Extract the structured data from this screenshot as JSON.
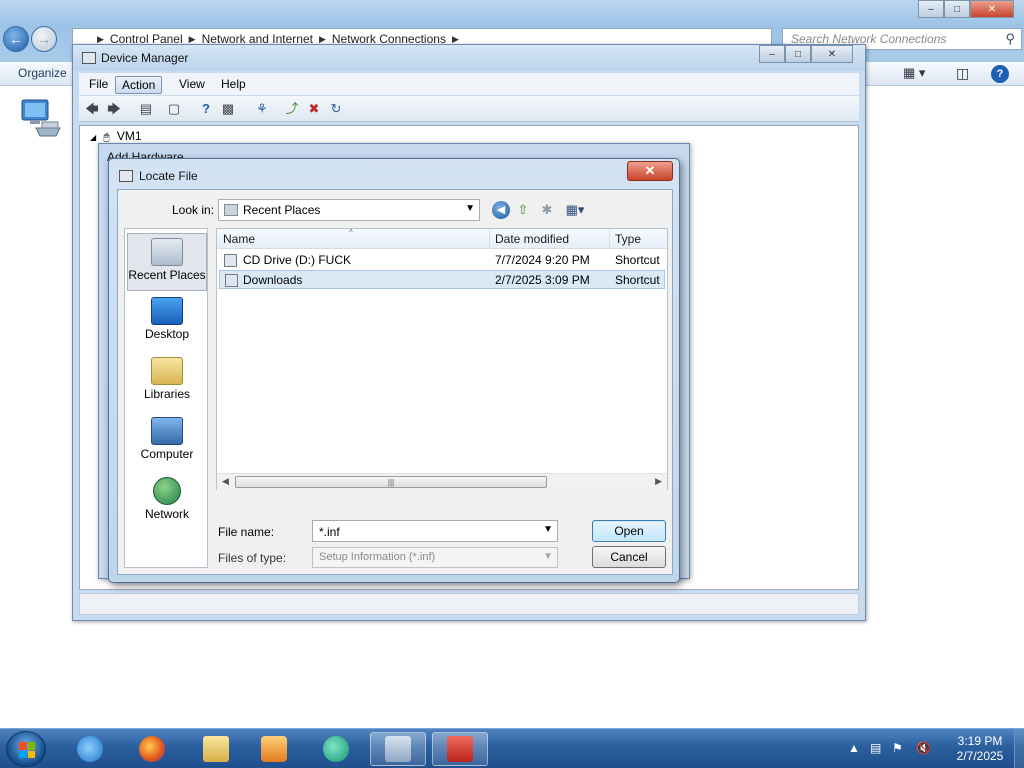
{
  "explorer": {
    "breadcrumb": [
      "Control Panel",
      "Network and Internet",
      "Network Connections"
    ],
    "search_placeholder": "Search Network Connections",
    "toolbar": {
      "organize": "Organize"
    }
  },
  "device_manager": {
    "title": "Device Manager",
    "menu": [
      "File",
      "Action",
      "View",
      "Help"
    ],
    "active_menu": "Action",
    "tree_root": "VM1"
  },
  "add_hardware": {
    "title": "Add Hardware"
  },
  "locate_file": {
    "title": "Locate File",
    "look_in_label": "Look in:",
    "look_in_value": "Recent Places",
    "places": [
      "Recent Places",
      "Desktop",
      "Libraries",
      "Computer",
      "Network"
    ],
    "selected_place": "Recent Places",
    "columns": [
      "Name",
      "Date modified",
      "Type"
    ],
    "files": [
      {
        "name": "CD Drive (D:) FUCK",
        "date": "7/7/2024 9:20 PM",
        "type": "Shortcut"
      },
      {
        "name": "Downloads",
        "date": "2/7/2025 3:09 PM",
        "type": "Shortcut"
      }
    ],
    "selected_file": "Downloads",
    "file_name_label": "File name:",
    "file_name_value": "*.inf",
    "files_of_type_label": "Files of type:",
    "files_of_type_value": "Setup Information (*.inf)",
    "open_button": "Open",
    "cancel_button": "Cancel"
  },
  "taskbar": {
    "apps": [
      "internet-explorer",
      "firefox",
      "file-explorer",
      "media-player",
      "chat-app",
      "device-manager",
      "toolbox"
    ],
    "time": "3:19 PM",
    "date": "2/7/2025"
  },
  "colors": {
    "accent": "#1f5fb3",
    "selection": "#dbe9f7",
    "close_red": "#c9432b",
    "taskbar": "#2b5f9e"
  }
}
